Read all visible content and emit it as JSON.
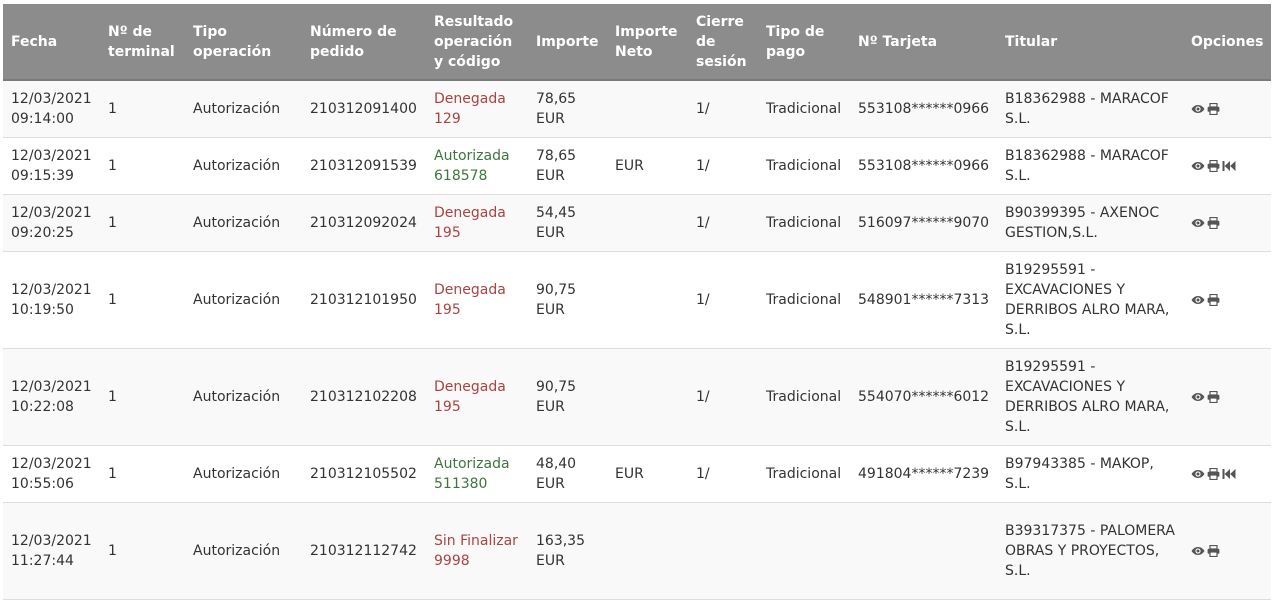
{
  "table": {
    "headers": {
      "fecha": "Fecha",
      "terminal": "Nº de terminal",
      "tipo_operacion": "Tipo operación",
      "numero_pedido": "Número de pedido",
      "resultado": "Resultado operación y código",
      "importe": "Importe",
      "importe_neto": "Importe Neto",
      "cierre": "Cierre de sesión",
      "tipo_pago": "Tipo de pago",
      "tarjeta": "Nº Tarjeta",
      "titular": "Titular",
      "opciones": "Opciones"
    },
    "rows": [
      {
        "fecha": "12/03/2021",
        "hora": "09:14:00",
        "terminal": "1",
        "tipo_operacion": "Autorización",
        "numero_pedido": "210312091400",
        "resultado": "Denegada",
        "codigo": "129",
        "status": "denied",
        "importe": "78,65",
        "moneda": "EUR",
        "importe_neto": "",
        "cierre": "1/",
        "tipo_pago": "Tradicional",
        "tarjeta": "553108******0966",
        "titular": "B18362988 - MARACOF S.L.",
        "refund": false
      },
      {
        "fecha": "12/03/2021",
        "hora": "09:15:39",
        "terminal": "1",
        "tipo_operacion": "Autorización",
        "numero_pedido": "210312091539",
        "resultado": "Autorizada",
        "codigo": "618578",
        "status": "ok",
        "importe": "78,65",
        "moneda": "EUR",
        "importe_neto": "EUR",
        "cierre": "1/",
        "tipo_pago": "Tradicional",
        "tarjeta": "553108******0966",
        "titular": "B18362988 - MARACOF S.L.",
        "refund": true
      },
      {
        "fecha": "12/03/2021",
        "hora": "09:20:25",
        "terminal": "1",
        "tipo_operacion": "Autorización",
        "numero_pedido": "210312092024",
        "resultado": "Denegada",
        "codigo": "195",
        "status": "denied",
        "importe": "54,45",
        "moneda": "EUR",
        "importe_neto": "",
        "cierre": "1/",
        "tipo_pago": "Tradicional",
        "tarjeta": "516097******9070",
        "titular": "B90399395 - AXENOC GESTION,S.L.",
        "refund": false
      },
      {
        "fecha": "12/03/2021",
        "hora": "10:19:50",
        "terminal": "1",
        "tipo_operacion": "Autorización",
        "numero_pedido": "210312101950",
        "resultado": "Denegada",
        "codigo": "195",
        "status": "denied",
        "importe": "90,75",
        "moneda": "EUR",
        "importe_neto": "",
        "cierre": "1/",
        "tipo_pago": "Tradicional",
        "tarjeta": "548901******7313",
        "titular": "B19295591 - EXCAVACIONES Y DERRIBOS ALRO MARA, S.L.",
        "refund": false
      },
      {
        "fecha": "12/03/2021",
        "hora": "10:22:08",
        "terminal": "1",
        "tipo_operacion": "Autorización",
        "numero_pedido": "210312102208",
        "resultado": "Denegada",
        "codigo": "195",
        "status": "denied",
        "importe": "90,75",
        "moneda": "EUR",
        "importe_neto": "",
        "cierre": "1/",
        "tipo_pago": "Tradicional",
        "tarjeta": "554070******6012",
        "titular": "B19295591 - EXCAVACIONES Y DERRIBOS ALRO MARA, S.L.",
        "refund": false
      },
      {
        "fecha": "12/03/2021",
        "hora": "10:55:06",
        "terminal": "1",
        "tipo_operacion": "Autorización",
        "numero_pedido": "210312105502",
        "resultado": "Autorizada",
        "codigo": "511380",
        "status": "ok",
        "importe": "48,40",
        "moneda": "EUR",
        "importe_neto": "EUR",
        "cierre": "1/",
        "tipo_pago": "Tradicional",
        "tarjeta": "491804******7239",
        "titular": "B97943385 - MAKOP, S.L.",
        "refund": true
      },
      {
        "fecha": "12/03/2021",
        "hora": "11:27:44",
        "terminal": "1",
        "tipo_operacion": "Autorización",
        "numero_pedido": "210312112742",
        "resultado": "Sin Finalizar",
        "codigo": "9998",
        "status": "denied",
        "importe": "163,35",
        "moneda": "EUR",
        "importe_neto": "",
        "cierre": "",
        "tipo_pago": "",
        "tarjeta": "",
        "titular": "B39317375 - PALOMERA OBRAS Y PROYECTOS, S.L.",
        "refund": false
      }
    ]
  },
  "colors": {
    "header_bg": "#8c8c8c",
    "denied": "#a94442",
    "ok": "#3c763d",
    "icon": "#555555"
  },
  "icons": {
    "view": "eye-icon",
    "print": "print-icon",
    "refund": "backward-icon"
  }
}
